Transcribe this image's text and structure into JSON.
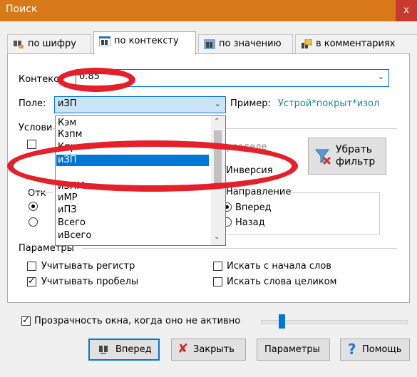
{
  "window": {
    "title": "Поиск",
    "close": "x"
  },
  "tabs": [
    {
      "label": "по шифру",
      "icon": "binoculars-key-icon"
    },
    {
      "label": "по контексту",
      "icon": "binoculars-doc-icon"
    },
    {
      "label": "по значению",
      "icon": "binoculars-table-icon"
    },
    {
      "label": "в комментариях",
      "icon": "binoculars-note-icon"
    }
  ],
  "context": {
    "label": "Контекс",
    "value": "0.85"
  },
  "field": {
    "label": "Поле:",
    "value": "иЗП",
    "example_label": "Пример:",
    "example_value": "Устрой*покрыт*изол"
  },
  "conditions": {
    "label": "Услови",
    "in_section": "разделе",
    "inversion": "Инверсия",
    "remove_filter": "Убрать фильтр",
    "remove_filter_line1": "Убрать",
    "remove_filter_line2": "фильтр"
  },
  "origin": {
    "label": "Отк"
  },
  "direction": {
    "label": "Направление",
    "forward": "Вперед",
    "back": "Назад"
  },
  "dropdown_items": [
    "Кэм",
    "Кзпм",
    "Кпр",
    "иЗП",
    "",
    "иЗПМ",
    "иМР",
    "иПЗ",
    "Всего",
    "иВсего"
  ],
  "dropdown_selected": "иЗП",
  "params": {
    "label": "Параметры",
    "match_case": "Учитывать регистр",
    "match_spaces": "Учитывать пробелы",
    "word_start": "Искать с начала слов",
    "whole_words": "Искать слова целиком"
  },
  "transparency": {
    "label": "Прозрачность окна, когда оно не активно",
    "checked": true,
    "level_percent": 13
  },
  "buttons": {
    "forward": "Вперед",
    "close": "Закрыть",
    "params": "Параметры",
    "help": "Помощь"
  },
  "colors": {
    "accent": "#0078d7",
    "title_bar": "#d87a18",
    "close": "#c63b2c",
    "annotation": "#e5202a",
    "example": "#1a8a8a"
  }
}
